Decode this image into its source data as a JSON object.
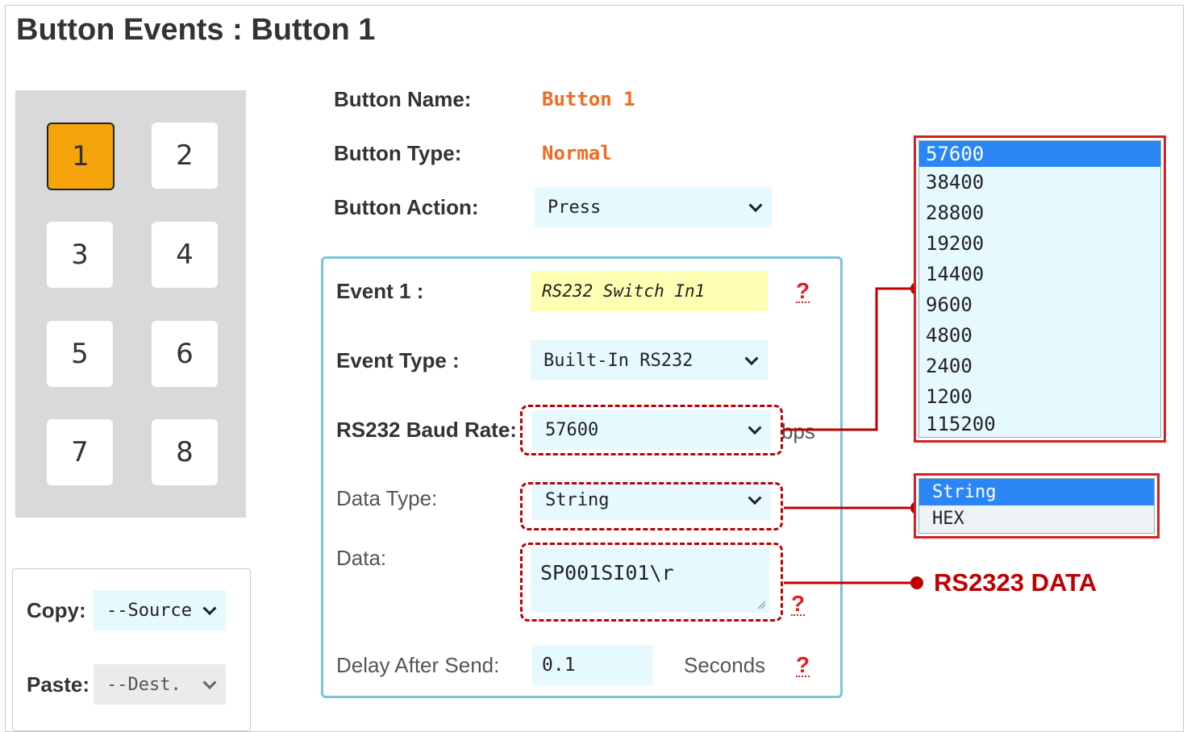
{
  "page": {
    "title": "Button Events : Button 1"
  },
  "keypad": {
    "keys": [
      "1",
      "2",
      "3",
      "4",
      "5",
      "6",
      "7",
      "8"
    ],
    "active": "1"
  },
  "copy_paste": {
    "copy_label": "Copy:",
    "copy_value": "--Source",
    "paste_label": "Paste:",
    "paste_value": "--Dest."
  },
  "button": {
    "name_label": "Button Name:",
    "name_value": "Button 1",
    "type_label": "Button Type:",
    "type_value": "Normal",
    "action_label": "Button Action:",
    "action_value": "Press"
  },
  "event": {
    "event_label": "Event 1 :",
    "event_name": "RS232 Switch In1",
    "type_label": "Event Type :",
    "type_value": "Built-In RS232",
    "baud_label": "RS232 Baud Rate:",
    "baud_value": "57600",
    "baud_unit": "bps",
    "datatype_label": "Data Type:",
    "datatype_value": "String",
    "data_label": "Data:",
    "data_value": "SP001SI01\\r",
    "delay_label": "Delay After Send:",
    "delay_value": "0.1",
    "delay_unit": "Seconds",
    "help": "?"
  },
  "baud_options": [
    "57600",
    "38400",
    "28800",
    "19200",
    "14400",
    "9600",
    "4800",
    "2400",
    "1200",
    "115200"
  ],
  "baud_selected": "57600",
  "datatype_options": [
    "String",
    "HEX"
  ],
  "datatype_selected": "String",
  "annotation": "RS2323 DATA",
  "colors": {
    "accent_red": "#c00000",
    "orange_text": "#f26a21",
    "active_key": "#f5a40c",
    "input_bg": "#e6f9ff",
    "selected_option": "#2b86f5"
  }
}
